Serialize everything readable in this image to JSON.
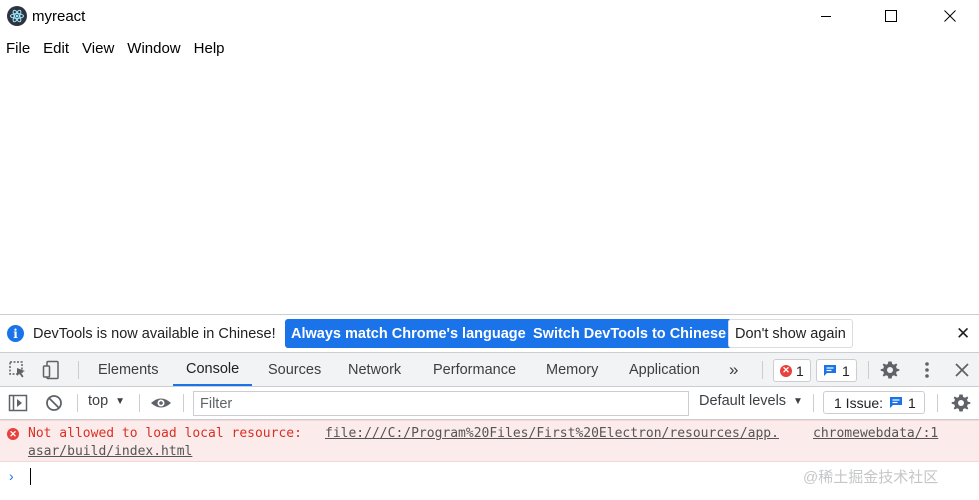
{
  "window": {
    "title": "myreact",
    "icon": "electron-icon"
  },
  "menu": [
    "File",
    "Edit",
    "View",
    "Window",
    "Help"
  ],
  "devtools": {
    "infobar": {
      "message": "DevTools is now available in Chinese!",
      "btn_match": "Always match Chrome's language",
      "btn_switch": "Switch DevTools to Chinese",
      "btn_dismiss": "Don't show again"
    },
    "tabs": [
      "Elements",
      "Console",
      "Sources",
      "Network",
      "Performance",
      "Memory",
      "Application"
    ],
    "active_tab": "Console",
    "more_tabs": "»",
    "error_count": "1",
    "message_count": "1",
    "filterbar": {
      "context": "top",
      "filter_placeholder": "Filter",
      "levels": "Default levels",
      "issues_label": "1 Issue:",
      "issues_count": "1"
    },
    "console": {
      "error_text": "Not allowed to load local resource:",
      "error_url": "file:///C:/Program%20Files/First%20Electron/resources/app.",
      "error_url_cont": "asar/build/index.html",
      "error_source": "chromewebdata/:1"
    }
  },
  "watermark": "@稀土掘金技术社区",
  "colors": {
    "accent": "#1a73e8",
    "error_bg": "#fcebeb",
    "error_text": "#d93025",
    "toolbar_bg": "#f1f3f4"
  }
}
